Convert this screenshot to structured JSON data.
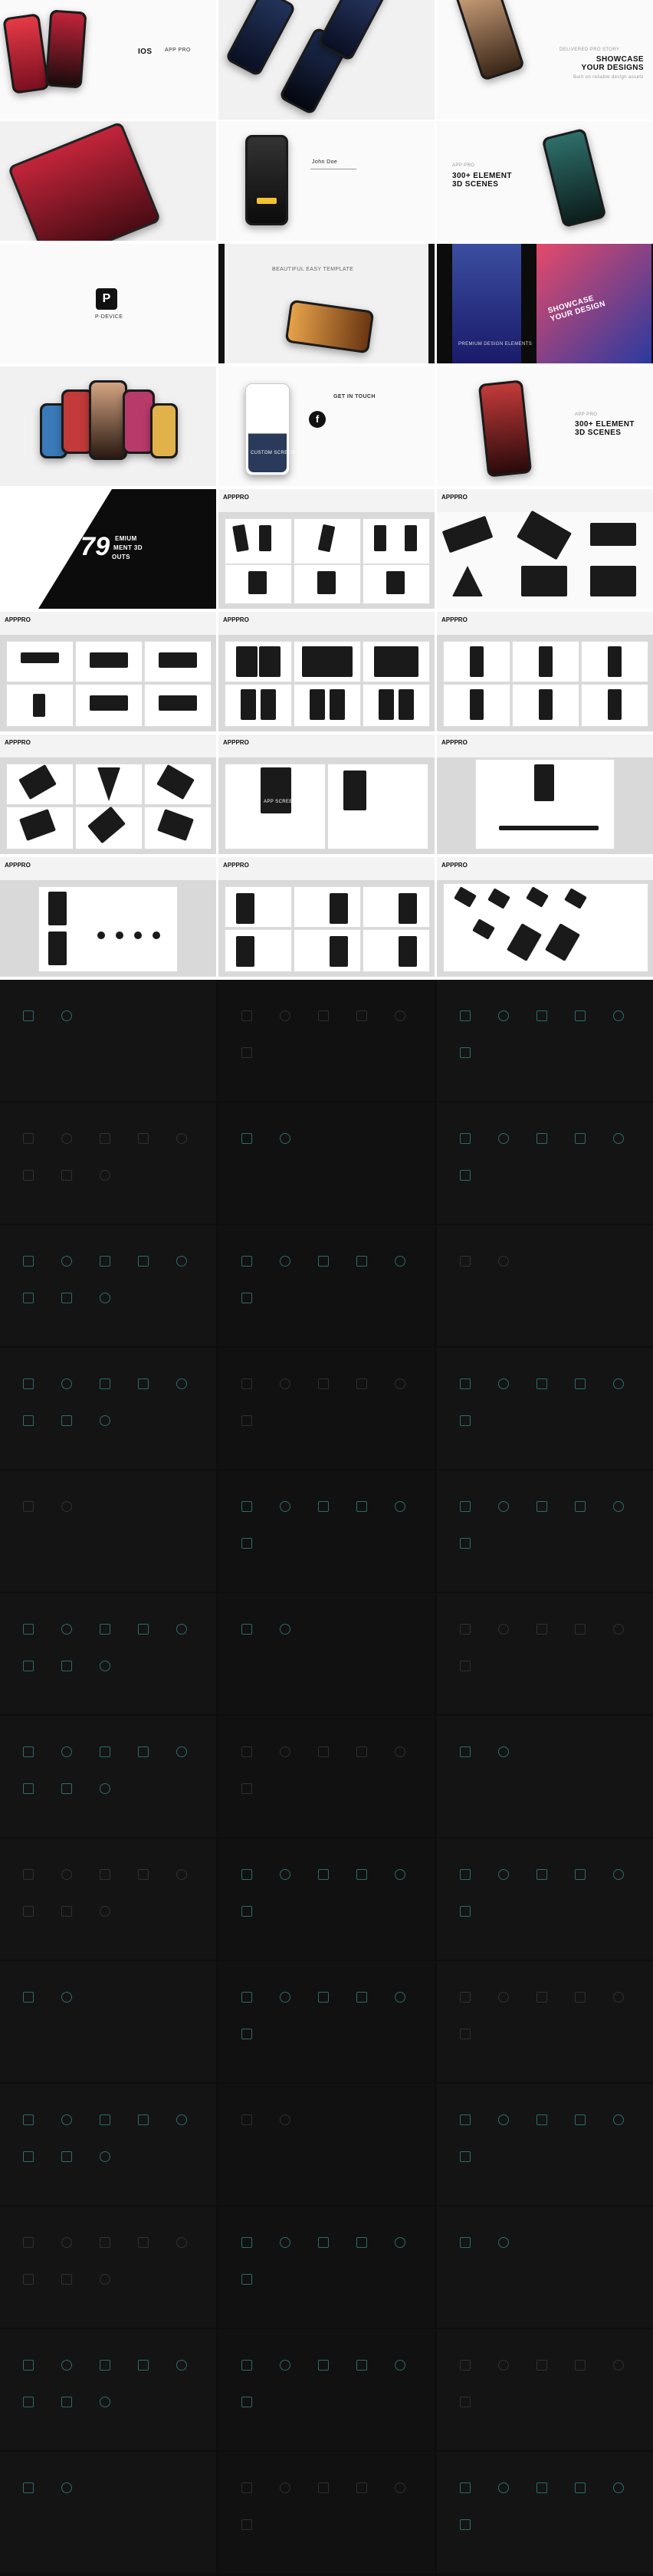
{
  "slides": {
    "r1": {
      "a": {
        "os": "IOS",
        "brand": "APP PRO"
      },
      "b": {
        "label": ""
      },
      "c": {
        "title": "SHOWCASE YOUR DESIGNS",
        "sub": "DELIVERED PRO STORY",
        "note": "Built on reliable design assets"
      }
    },
    "r2": {
      "a": {
        "label": ""
      },
      "b": {
        "name": "John Doe",
        "brand": "APP PRO"
      },
      "c": {
        "title": "300+ ELEMENT 3D SCENES",
        "brand": "APP PRO"
      }
    },
    "r3": {
      "a": {
        "device": "P-DEVICE"
      },
      "b": {
        "title": "BEAUTIFUL EASY TEMPLATE"
      },
      "c": {
        "title": "SHOWCASE YOUR DESIGN",
        "sub": "PREMIUM DESIGN ELEMENTS"
      }
    },
    "r4": {
      "a": {
        "label": ""
      },
      "b": {
        "title": "GET IN TOUCH",
        "screen": "CUSTOM SCREEN"
      },
      "c": {
        "brand": "APP PRO",
        "title": "300+ ELEMENT 3D SCENES"
      }
    },
    "r5": {
      "a": {
        "number": "79",
        "l1": "EMIUM",
        "l2": "MENT 3D",
        "l3": "OUTS"
      },
      "b": {
        "logo": "APPPRO"
      },
      "c": {
        "logo": "APPPRO"
      }
    },
    "r6": {
      "a": {
        "logo": "APPPRO"
      },
      "b": {
        "logo": "APPPRO"
      },
      "c": {
        "logo": "APPPRO"
      }
    },
    "r7": {
      "a": {
        "logo": "APPPRO"
      },
      "b": {
        "logo": "APPPRO",
        "screen": "APP SCREEN"
      },
      "c": {
        "logo": "APPPRO"
      }
    },
    "r8": {
      "a": {
        "logo": "APPPRO"
      },
      "b": {
        "logo": "APPPRO"
      },
      "c": {
        "logo": "APPPRO"
      }
    }
  },
  "colors": {
    "accent": "#3b8f8f",
    "red": "#e63946",
    "dark": "#141414"
  }
}
